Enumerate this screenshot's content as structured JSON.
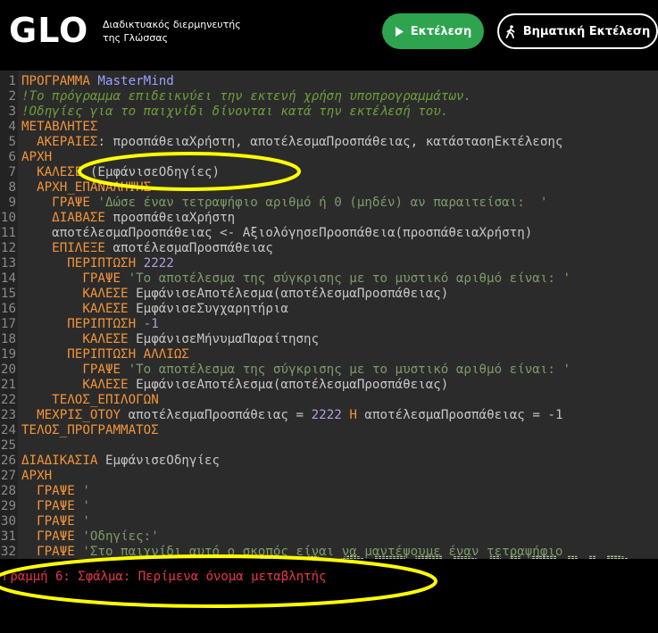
{
  "header": {
    "logo": "GLO",
    "tagline": "Διαδικτυακός διερμηνευτής της Γλώσσας",
    "run_label": "Εκτέλεση",
    "step_label": "Βηματική Εκτέλεση",
    "run_icon": "play-icon",
    "step_icon": "walking-person-icon"
  },
  "colors": {
    "keyword": "#f2943a",
    "comment": "#6e9d3c",
    "string": "#7e9a6a",
    "number": "#b49cdd",
    "error": "#e8364a",
    "run_button": "#2ea44f",
    "highlight": "#ffff00"
  },
  "editor": {
    "lines": [
      {
        "n": "1",
        "seg": [
          {
            "t": "ΠΡΟΓΡΑΜΜΑ",
            "c": "kw"
          },
          {
            "t": " MasterMind",
            "c": "pn"
          }
        ]
      },
      {
        "n": "2",
        "seg": [
          {
            "t": "!Το πρόγραμμα επιδεικνύει την εκτενή χρήση υποπρογραμμάτων.",
            "c": "cm"
          }
        ]
      },
      {
        "n": "3",
        "seg": [
          {
            "t": "!Οδηγίες για το παιχνίδι δίνονται κατά την εκτέλεσή του.",
            "c": "cm"
          }
        ]
      },
      {
        "n": "4",
        "seg": [
          {
            "t": "ΜΕΤΑΒΛΗΤΕΣ",
            "c": "kw"
          }
        ]
      },
      {
        "n": "5",
        "seg": [
          {
            "t": "  ",
            "c": "tx"
          },
          {
            "t": "ΑΚΕΡΑΙΕΣ",
            "c": "kw"
          },
          {
            "t": ": προσπάθειαΧρήστη, αποτέλεσμαΠροσπάθειας, κατάστασηΕκτέλεσης",
            "c": "tx"
          }
        ]
      },
      {
        "n": "6",
        "seg": [
          {
            "t": "ΑΡΧΗ",
            "c": "kw"
          }
        ]
      },
      {
        "n": "7",
        "seg": [
          {
            "t": "  ",
            "c": "tx"
          },
          {
            "t": "ΚΑΛΕΣΕ",
            "c": "kw"
          },
          {
            "t": " (ΕμφάνισεΟδηγίες)",
            "c": "tx"
          }
        ]
      },
      {
        "n": "8",
        "seg": [
          {
            "t": "  ",
            "c": "tx"
          },
          {
            "t": "ΑΡΧΗ_ΕΠΑΝΑΛΗΨΗΣ",
            "c": "kw"
          }
        ]
      },
      {
        "n": "9",
        "seg": [
          {
            "t": "    ",
            "c": "tx"
          },
          {
            "t": "ΓΡΑΨΕ",
            "c": "kw"
          },
          {
            "t": " 'Δώσε έναν τετραψήφιο αριθμό ή 0 (μηδέν) αν παραιτείσαι:  '",
            "c": "st"
          }
        ]
      },
      {
        "n": "10",
        "seg": [
          {
            "t": "    ",
            "c": "tx"
          },
          {
            "t": "ΔΙΑΒΑΣΕ",
            "c": "kw"
          },
          {
            "t": " προσπάθειαΧρήστη",
            "c": "tx"
          }
        ]
      },
      {
        "n": "11",
        "seg": [
          {
            "t": "    αποτέλεσμαΠροσπάθειας <- ΑξιολόγησεΠροσπάθεια(προσπάθειαΧρήστη)",
            "c": "tx"
          }
        ]
      },
      {
        "n": "12",
        "seg": [
          {
            "t": "    ",
            "c": "tx"
          },
          {
            "t": "ΕΠΙΛΕΞΕ",
            "c": "kw"
          },
          {
            "t": " αποτέλεσμαΠροσπάθειας",
            "c": "tx"
          }
        ]
      },
      {
        "n": "13",
        "seg": [
          {
            "t": "      ",
            "c": "tx"
          },
          {
            "t": "ΠΕΡΙΠΤΩΣΗ",
            "c": "kw"
          },
          {
            "t": " 2222",
            "c": "nm"
          }
        ]
      },
      {
        "n": "14",
        "seg": [
          {
            "t": "        ",
            "c": "tx"
          },
          {
            "t": "ΓΡΑΨΕ",
            "c": "kw"
          },
          {
            "t": " 'Το αποτέλεσμα της σύγκρισης με το μυστικό αριθμό είναι: '",
            "c": "st"
          }
        ]
      },
      {
        "n": "15",
        "seg": [
          {
            "t": "        ",
            "c": "tx"
          },
          {
            "t": "ΚΑΛΕΣΕ",
            "c": "kw"
          },
          {
            "t": " ΕμφάνισεΑποτέλεσμα(αποτέλεσμαΠροσπάθειας)",
            "c": "tx"
          }
        ]
      },
      {
        "n": "16",
        "seg": [
          {
            "t": "        ",
            "c": "tx"
          },
          {
            "t": "ΚΑΛΕΣΕ",
            "c": "kw"
          },
          {
            "t": " ΕμφάνισεΣυγχαρητήρια",
            "c": "tx"
          }
        ]
      },
      {
        "n": "17",
        "seg": [
          {
            "t": "      ",
            "c": "tx"
          },
          {
            "t": "ΠΕΡΙΠΤΩΣΗ",
            "c": "kw"
          },
          {
            "t": " -1",
            "c": "nm"
          }
        ]
      },
      {
        "n": "18",
        "seg": [
          {
            "t": "        ",
            "c": "tx"
          },
          {
            "t": "ΚΑΛΕΣΕ",
            "c": "kw"
          },
          {
            "t": " ΕμφάνισεΜήνυμαΠαραίτησης",
            "c": "tx"
          }
        ]
      },
      {
        "n": "19",
        "seg": [
          {
            "t": "      ",
            "c": "tx"
          },
          {
            "t": "ΠΕΡΙΠΤΩΣΗ ΑΛΛΙΩΣ",
            "c": "kw"
          }
        ]
      },
      {
        "n": "20",
        "seg": [
          {
            "t": "        ",
            "c": "tx"
          },
          {
            "t": "ΓΡΑΨΕ",
            "c": "kw"
          },
          {
            "t": " 'Το αποτέλεσμα της σύγκρισης με το μυστικό αριθμό είναι: '",
            "c": "st"
          }
        ]
      },
      {
        "n": "21",
        "seg": [
          {
            "t": "        ",
            "c": "tx"
          },
          {
            "t": "ΚΑΛΕΣΕ",
            "c": "kw"
          },
          {
            "t": " ΕμφάνισεΑποτέλεσμα(αποτέλεσμαΠροσπάθειας)",
            "c": "tx"
          }
        ]
      },
      {
        "n": "22",
        "seg": [
          {
            "t": "    ",
            "c": "tx"
          },
          {
            "t": "ΤΕΛΟΣ_ΕΠΙΛΟΓΩΝ",
            "c": "kw"
          }
        ]
      },
      {
        "n": "23",
        "seg": [
          {
            "t": "  ",
            "c": "tx"
          },
          {
            "t": "ΜΕΧΡΙΣ_ΟΤΟΥ",
            "c": "kw"
          },
          {
            "t": " αποτέλεσμαΠροσπάθειας = ",
            "c": "tx"
          },
          {
            "t": "2222",
            "c": "nm"
          },
          {
            "t": " Η",
            "c": "kw"
          },
          {
            "t": " αποτέλεσμαΠροσπάθειας = -1",
            "c": "tx"
          }
        ]
      },
      {
        "n": "24",
        "seg": [
          {
            "t": "ΤΕΛΟΣ_ΠΡΟΓΡΑΜΜΑΤΟΣ",
            "c": "kw"
          }
        ]
      },
      {
        "n": "25",
        "seg": []
      },
      {
        "n": "26",
        "seg": [
          {
            "t": "ΔΙΑΔΙΚΑΣΙΑ",
            "c": "kw"
          },
          {
            "t": " ΕμφάνισεΟδηγίες",
            "c": "tx"
          }
        ]
      },
      {
        "n": "27",
        "seg": [
          {
            "t": "ΑΡΧΗ",
            "c": "kw"
          }
        ]
      },
      {
        "n": "28",
        "seg": [
          {
            "t": "  ",
            "c": "tx"
          },
          {
            "t": "ΓΡΑΨΕ",
            "c": "kw"
          },
          {
            "t": " '",
            "c": "st"
          }
        ]
      },
      {
        "n": "29",
        "seg": [
          {
            "t": "  ",
            "c": "tx"
          },
          {
            "t": "ΓΡΑΨΕ",
            "c": "kw"
          },
          {
            "t": " '",
            "c": "st"
          }
        ]
      },
      {
        "n": "30",
        "seg": [
          {
            "t": "  ",
            "c": "tx"
          },
          {
            "t": "ΓΡΑΨΕ",
            "c": "kw"
          },
          {
            "t": " '",
            "c": "st"
          }
        ]
      },
      {
        "n": "31",
        "seg": [
          {
            "t": "  ",
            "c": "tx"
          },
          {
            "t": "ΓΡΑΨΕ",
            "c": "kw"
          },
          {
            "t": " 'Οδηγίες:'",
            "c": "st"
          }
        ]
      },
      {
        "n": "32",
        "seg": [
          {
            "t": "  ",
            "c": "tx"
          },
          {
            "t": "ΓΡΑΨΕ",
            "c": "kw"
          },
          {
            "t": " 'Στο παιχνίδι αυτό ο σκοπός είναι να μαντέψουμε έναν τετραψήφιο",
            "c": "st"
          }
        ]
      }
    ],
    "ascii_banner": "MASTERMIND"
  },
  "error": {
    "message": "Γραμμή 6: Σφάλμα: Περίμενα όνομα μεταβλητής"
  }
}
